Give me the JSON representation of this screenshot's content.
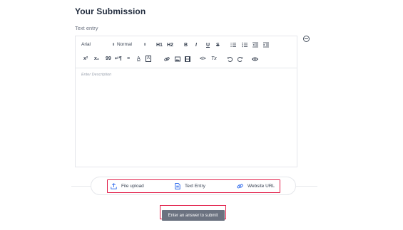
{
  "submission": {
    "title": "Your Submission",
    "subtitle": "Text entry"
  },
  "editor": {
    "font_family": "Arial",
    "font_size": "Normal",
    "placeholder": "Enter Description",
    "toolbar_row1": [
      "H1",
      "H2",
      "B",
      "I",
      "U",
      "S"
    ],
    "toolbar_row2": [
      "x²",
      "x₂",
      "99",
      "↵¶",
      "≡",
      "A",
      "A",
      "link",
      "image",
      "video",
      "</>",
      "Tx",
      "undo",
      "redo",
      "view"
    ]
  },
  "submission_types": {
    "file_upload": "File upload",
    "text_entry": "Text Entry",
    "website_url": "Website URL"
  },
  "submit_button": {
    "label": "Enter an answer to submit"
  },
  "colors": {
    "highlight": "#e11d48",
    "button_bg": "#6b7280",
    "icon_blue": "#2563eb"
  }
}
